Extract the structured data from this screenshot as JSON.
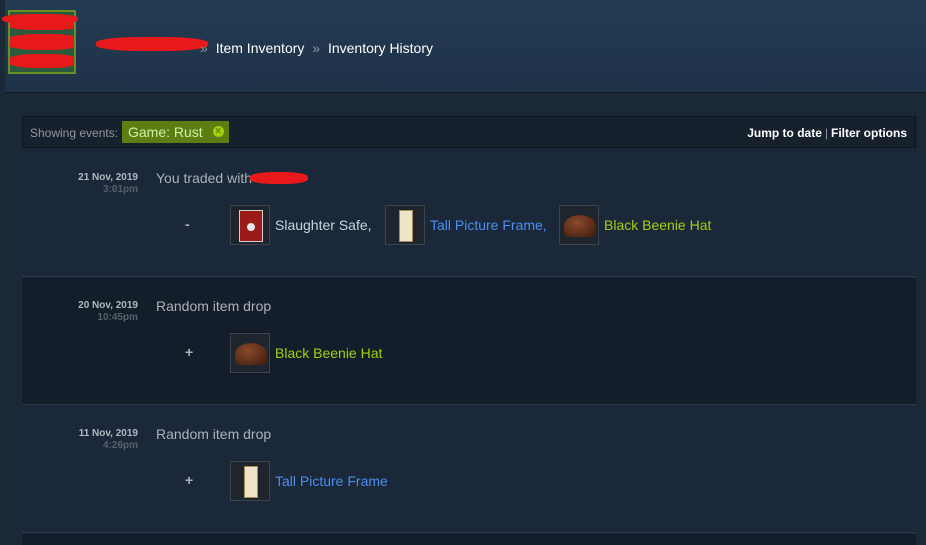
{
  "breadcrumb": {
    "separator": "»",
    "items": [
      "Item Inventory",
      "Inventory History"
    ]
  },
  "filter_bar": {
    "showing_label": "Showing events:",
    "game_chip": "Game: Rust",
    "jump_to_date": "Jump to date",
    "separator": "|",
    "filter_options": "Filter options"
  },
  "history": [
    {
      "date": "21 Nov, 2019",
      "time": "3:01pm",
      "description": "You traded with",
      "sign": "-",
      "items": [
        {
          "name": "Slaughter Safe,",
          "quality_color": "#c6d4df",
          "icon": "safe-icon"
        },
        {
          "name": "Tall Picture Frame,",
          "quality_color": "#4b8ff0",
          "icon": "frame-icon"
        },
        {
          "name": "Black Beenie Hat",
          "quality_color": "#a4d007",
          "icon": "hat-icon"
        }
      ]
    },
    {
      "date": "20 Nov, 2019",
      "time": "10:45pm",
      "description": "Random item drop",
      "sign": "+",
      "items": [
        {
          "name": "Black Beenie Hat",
          "quality_color": "#a4d007",
          "icon": "hat-icon"
        }
      ]
    },
    {
      "date": "11 Nov, 2019",
      "time": "4:26pm",
      "description": "Random item drop",
      "sign": "+",
      "items": [
        {
          "name": "Tall Picture Frame",
          "quality_color": "#4b8ff0",
          "icon": "frame-icon"
        }
      ]
    }
  ]
}
